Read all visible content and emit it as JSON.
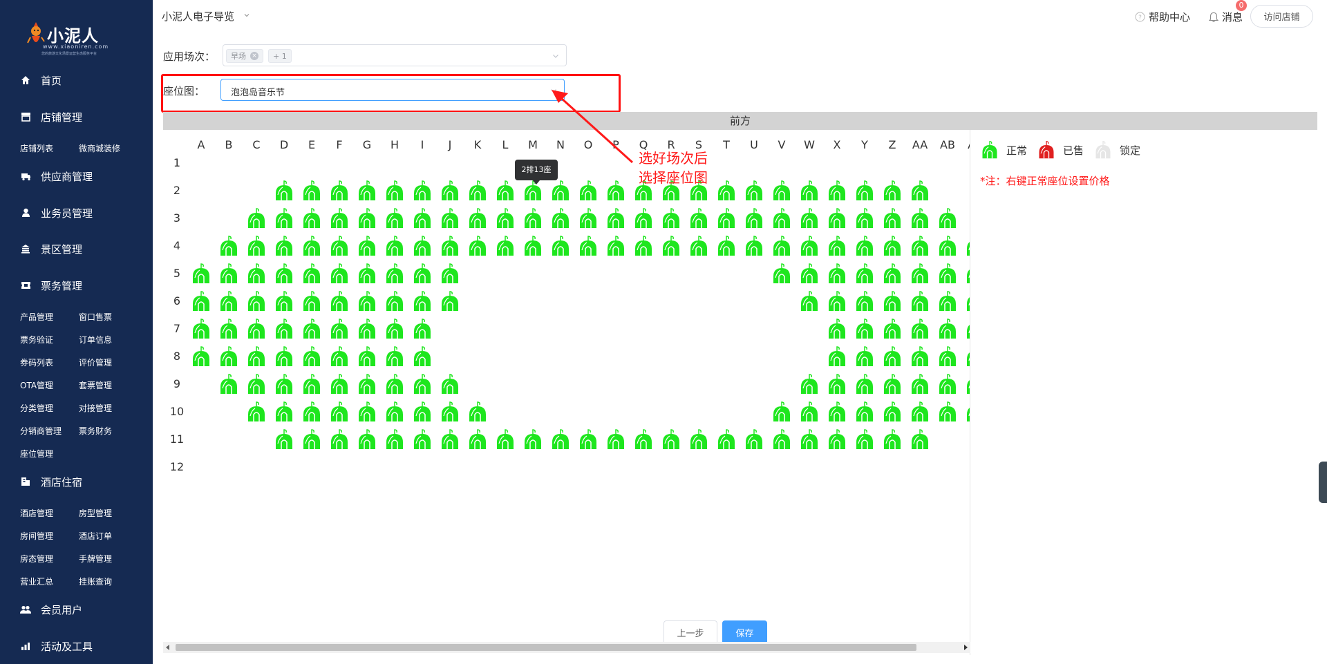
{
  "brand": {
    "name": "小泥人",
    "url": "www.xiaoniren.com",
    "slogan": "您的旅游文化场景运营生态服务平台"
  },
  "sidebar": {
    "home": "首页",
    "shop_mgmt": "店铺管理",
    "shop_subs": [
      "店铺列表",
      "微商城装修"
    ],
    "supplier_mgmt": "供应商管理",
    "sales_mgmt": "业务员管理",
    "scenic_mgmt": "景区管理",
    "ticket_mgmt": "票务管理",
    "ticket_subs": [
      "产品管理",
      "窗口售票",
      "票务验证",
      "订单信息",
      "券码列表",
      "评价管理",
      "OTA管理",
      "套票管理",
      "分类管理",
      "对接管理",
      "分销商管理",
      "票务财务",
      "座位管理"
    ],
    "hotel": "酒店住宿",
    "hotel_subs": [
      "酒店管理",
      "房型管理",
      "房间管理",
      "酒店订单",
      "房态管理",
      "手牌管理",
      "营业汇总",
      "挂账查询"
    ],
    "members": "会员用户",
    "activities": "活动及工具"
  },
  "topbar": {
    "shop_name": "小泥人电子导览",
    "help": "帮助中心",
    "messages": "消息",
    "message_count": "0",
    "visit_shop": "访问店铺"
  },
  "form": {
    "session_label": "应用场次：",
    "session_tags": [
      "早场",
      "+ 1"
    ],
    "seatmap_label": "座位图：",
    "seatmap_value": "泡泡岛音乐节"
  },
  "seatmap": {
    "front_label": "前方",
    "columns": [
      "A",
      "B",
      "C",
      "D",
      "E",
      "F",
      "G",
      "H",
      "I",
      "J",
      "K",
      "L",
      "M",
      "N",
      "O",
      "P",
      "Q",
      "R",
      "S",
      "T",
      "U",
      "V",
      "W",
      "X",
      "Y",
      "Z",
      "AA",
      "AB",
      "AC"
    ],
    "rows": [
      "1",
      "2",
      "3",
      "4",
      "5",
      "6",
      "7",
      "8",
      "9",
      "10",
      "11",
      "12"
    ],
    "seats": {
      "2": [
        [
          3,
          26
        ]
      ],
      "3": [
        [
          2,
          27
        ]
      ],
      "4": [
        [
          1,
          28
        ]
      ],
      "5": [
        [
          0,
          9
        ],
        [
          21,
          28
        ]
      ],
      "6": [
        [
          0,
          9
        ],
        [
          22,
          28
        ]
      ],
      "7": [
        [
          0,
          8
        ],
        [
          23,
          28
        ]
      ],
      "8": [
        [
          0,
          8
        ],
        [
          23,
          28
        ]
      ],
      "9": [
        [
          1,
          9
        ],
        [
          22,
          28
        ]
      ],
      "10": [
        [
          2,
          10
        ],
        [
          21,
          28
        ]
      ],
      "11": [
        [
          3,
          26
        ]
      ]
    },
    "tooltip": "2排13座",
    "colors": {
      "normal": "#1ee61e",
      "sold": "#e02020",
      "locked": "#e6e6e6"
    }
  },
  "legend": {
    "normal": "正常",
    "sold": "已售",
    "locked": "锁定",
    "note": "*注：右键正常座位设置价格"
  },
  "annotation": [
    "选好场次后",
    "选择座位图"
  ],
  "buttons": {
    "prev": "上一步",
    "save": "保存"
  }
}
